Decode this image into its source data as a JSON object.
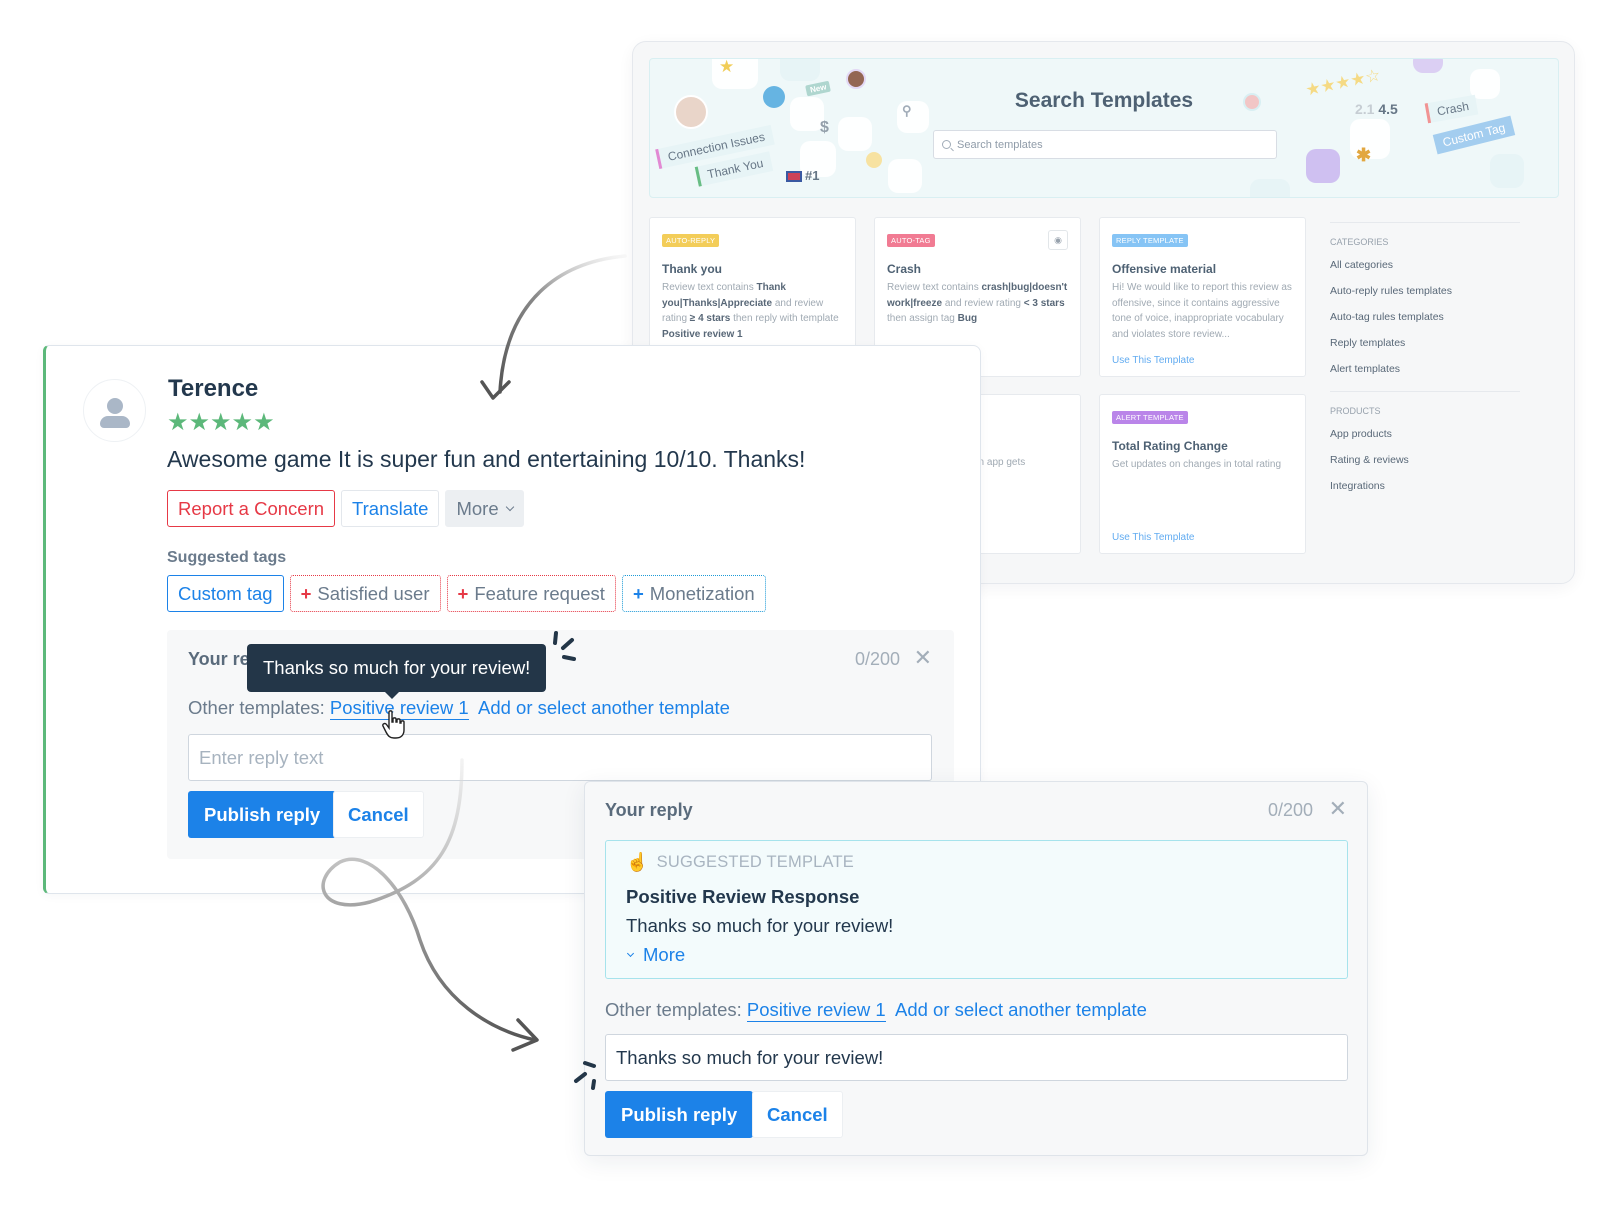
{
  "templates_window": {
    "title": "Search Templates",
    "search_placeholder": "Search templates",
    "hero_decorations": {
      "tag_connection": "Connection Issues",
      "tag_thankyou": "Thank You",
      "badge_new": "New",
      "rank": "#1",
      "rating_from": "2.1",
      "rating_to": "4.5",
      "tag_crash": "Crash",
      "tag_custom": "Custom Tag"
    },
    "cards": [
      {
        "badge": "AUTO-REPLY",
        "badge_color": "#f2c94c",
        "title": "Thank you",
        "desc_parts": [
          "Review text contains ",
          "Thank you|Thanks|Appreciate",
          " and review rating ",
          "≥ 4 stars",
          " then reply with template ",
          "Positive review 1"
        ]
      },
      {
        "badge": "AUTO-TAG",
        "badge_color": "#f0708a",
        "title": "Crash",
        "desc_parts": [
          "Review text contains ",
          "crash|bug|doesn't work|freeze",
          " and review rating ",
          "< 3 stars",
          " then assign tag ",
          "Bug"
        ]
      },
      {
        "badge": "REPLY TEMPLATE",
        "badge_color": "#7cc0f5",
        "title": "Offensive material",
        "desc": "Hi! We would like to report this review as offensive, since it contains aggressive tone of voice, inappropriate vocabulary and violates store review...",
        "link": "Use This Template"
      },
      {
        "partial_desc": "an app gets"
      },
      {
        "badge": "ALERT TEMPLATE",
        "badge_color": "#b57be8",
        "title": "Total Rating Change",
        "desc": "Get updates on changes in total rating",
        "link": "Use This Template"
      }
    ],
    "sidebar": {
      "categories_heading": "CATEGORIES",
      "categories": [
        "All categories",
        "Auto-reply rules templates",
        "Auto-tag rules templates",
        "Reply templates",
        "Alert templates"
      ],
      "products_heading": "PRODUCTS",
      "products": [
        "App products",
        "Rating & reviews",
        "Integrations"
      ]
    }
  },
  "review": {
    "reviewer": "Terence",
    "rating": 5,
    "rating_max": 5,
    "stars_text": "★★★★★",
    "text": "Awesome game It is super fun and entertaining 10/10. Thanks!",
    "actions": {
      "report": "Report a Concern",
      "translate": "Translate",
      "more": "More"
    },
    "suggested_tags_label": "Suggested tags",
    "tags": [
      {
        "label": "Custom tag",
        "style": "selected"
      },
      {
        "label": "Satisfied user",
        "style": "red",
        "prefix": "+"
      },
      {
        "label": "Feature request",
        "style": "red",
        "prefix": "+"
      },
      {
        "label": "Monetization",
        "style": "blue",
        "prefix": "+"
      }
    ],
    "reply": {
      "label": "Your reply",
      "count": "0/200",
      "tooltip": "Thanks so much for your review!",
      "other_templates_label": "Other templates:",
      "template_link": "Positive review 1",
      "add_template_link": "Add or select another template",
      "input_placeholder": "Enter reply text",
      "input_value": "",
      "publish": "Publish reply",
      "cancel": "Cancel"
    }
  },
  "reply_panel": {
    "label": "Your reply",
    "count": "0/200",
    "suggested": {
      "heading": "SUGGESTED TEMPLATE",
      "title": "Positive Review Response",
      "text": "Thanks so much for your review!",
      "more": "More"
    },
    "other_templates_label": "Other templates:",
    "template_link": "Positive review 1",
    "add_template_link": "Add or select another template",
    "input_value": "Thanks so much for your review!",
    "publish": "Publish reply",
    "cancel": "Cancel"
  },
  "icons": {
    "close": "✕",
    "pointing_finger": "☝",
    "plus": "+",
    "eye": "◉"
  }
}
